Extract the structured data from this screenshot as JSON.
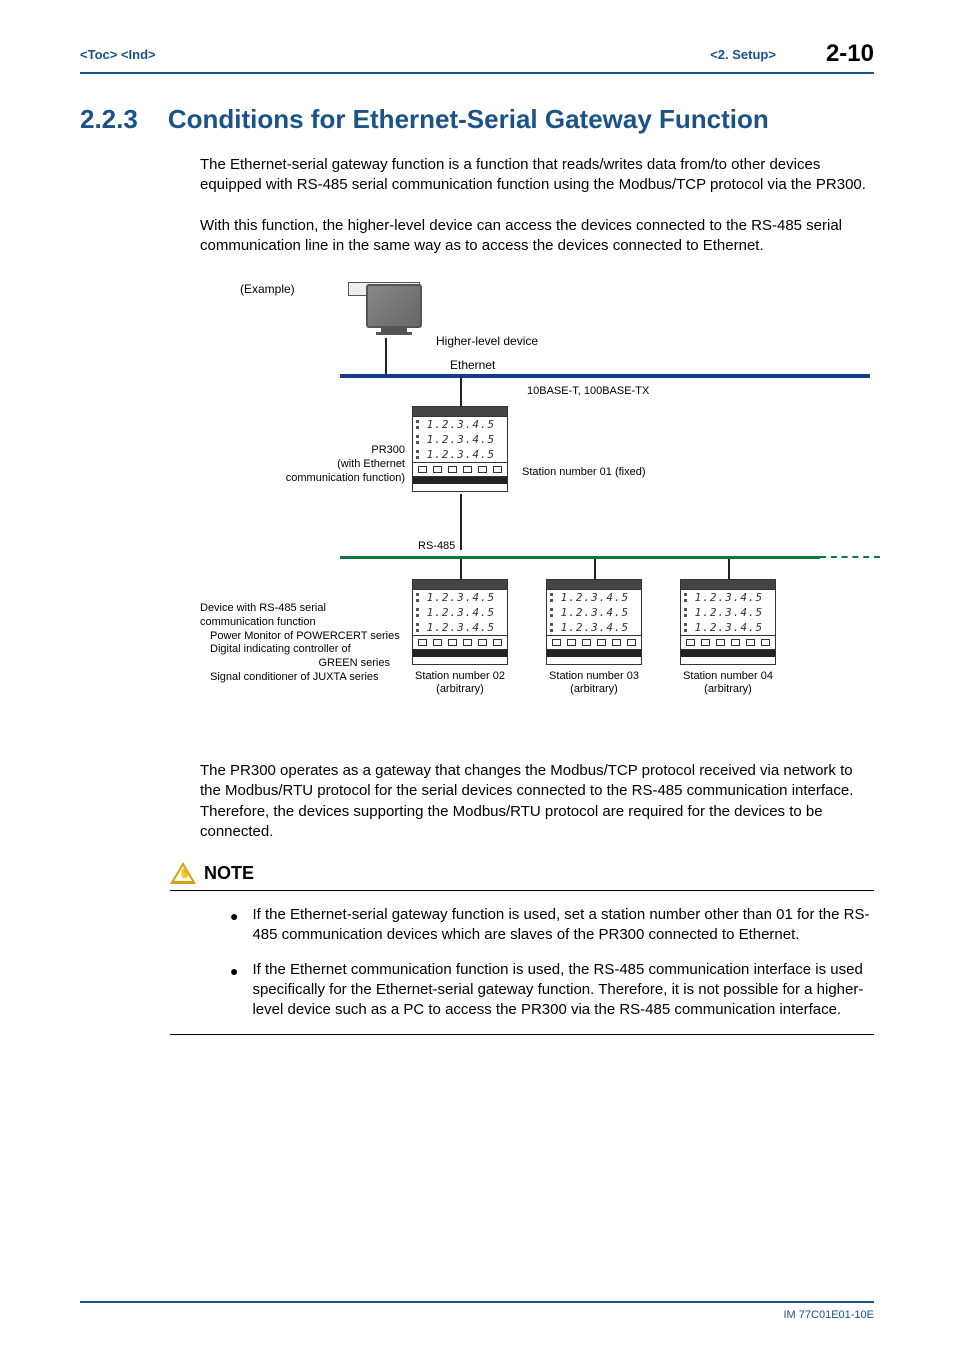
{
  "header": {
    "toc": "<Toc>",
    "ind": "<Ind>",
    "section": "<2.  Setup>",
    "page_number": "2-10"
  },
  "section": {
    "number": "2.2.3",
    "title": "Conditions for Ethernet-Serial Gateway Function"
  },
  "paragraphs": {
    "p1": "The Ethernet-serial gateway function is a function that reads/writes data from/to other devices equipped with RS-485 serial communication function using the Modbus/TCP protocol via the PR300.",
    "p2": "With this function, the higher-level device can access the devices connected to the RS-485 serial communication line in the same way as to access the devices connected to Ethernet.",
    "p3": "The PR300 operates as a gateway that changes the Modbus/TCP protocol received via network to the Modbus/RTU protocol for the serial devices connected to the RS-485 communication interface. Therefore, the devices supporting the Modbus/RTU protocol are required for the devices to be connected."
  },
  "diagram": {
    "example_label": "(Example)",
    "higher_level": "Higher-level device",
    "ethernet": "Ethernet",
    "base_tx": "10BASE-T, 100BASE-TX",
    "pr300_l1": "PR300",
    "pr300_l2": "(with Ethernet",
    "pr300_l3": "communication function)",
    "station01": "Station number 01 (fixed)",
    "rs485": "RS-485",
    "device_l1": "Device with RS-485 serial",
    "device_l2": "communication function",
    "device_l3": "Power Monitor of POWERCERT series",
    "device_l4": "Digital indicating controller of",
    "device_l5": "GREEN series",
    "device_l6": "Signal conditioner of JUXTA series",
    "station02_l1": "Station number 02",
    "station02_l2": "(arbitrary)",
    "station03_l1": "Station number 03",
    "station03_l2": "(arbitrary)",
    "station04_l1": "Station number 04",
    "station04_l2": "(arbitrary)",
    "digits": "1.2.3.4.5"
  },
  "note": {
    "label": "NOTE",
    "item1": "If the Ethernet-serial gateway function is used, set a station number other than 01 for the RS-485 communication devices which are slaves of the PR300 connected to Ethernet.",
    "item2": "If the Ethernet communication function is used, the RS-485 communication interface is used  specifically for the Ethernet-serial gateway function. Therefore, it is not possible for a higher-level device such as a PC to access the PR300 via the RS-485 communication interface."
  },
  "footer": {
    "docid": "IM 77C01E01-10E"
  }
}
